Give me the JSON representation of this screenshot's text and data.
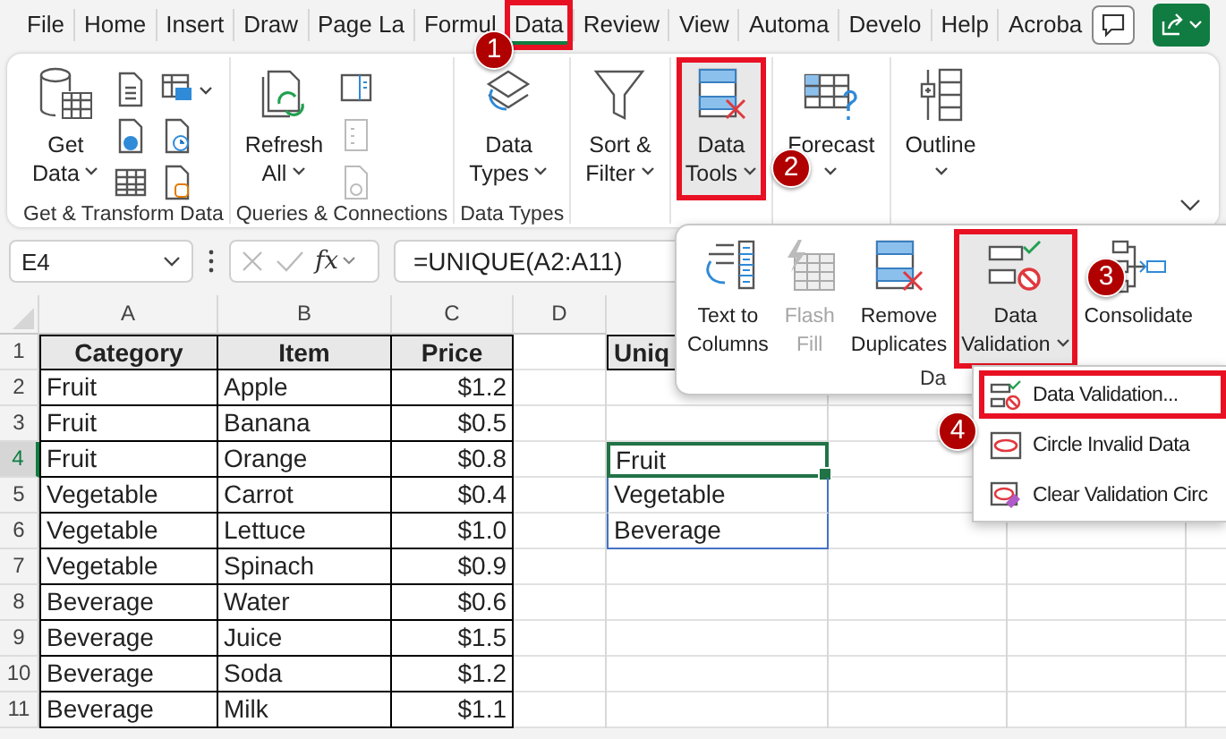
{
  "tabs": [
    {
      "label": "File",
      "selected": false,
      "highlighted": false
    },
    {
      "label": "Home",
      "selected": false,
      "highlighted": false
    },
    {
      "label": "Insert",
      "selected": false,
      "highlighted": false
    },
    {
      "label": "Draw",
      "selected": false,
      "highlighted": false
    },
    {
      "label": "Page La",
      "selected": false,
      "highlighted": false
    },
    {
      "label": "Formul",
      "selected": false,
      "highlighted": false
    },
    {
      "label": "Data",
      "selected": true,
      "highlighted": true
    },
    {
      "label": "Review",
      "selected": false,
      "highlighted": false
    },
    {
      "label": "View",
      "selected": false,
      "highlighted": false
    },
    {
      "label": "Automa",
      "selected": false,
      "highlighted": false
    },
    {
      "label": "Develo",
      "selected": false,
      "highlighted": false
    },
    {
      "label": "Help",
      "selected": false,
      "highlighted": false
    },
    {
      "label": "Acroba",
      "selected": false,
      "highlighted": false
    }
  ],
  "ribbon": {
    "groups": [
      {
        "label": "Get & Transform Data",
        "buttons": [
          {
            "lines": [
              "Get",
              "Data"
            ],
            "dropdown": true,
            "highlighted": false
          }
        ]
      },
      {
        "label": "Queries & Connections",
        "buttons": [
          {
            "lines": [
              "Refresh",
              "All"
            ],
            "dropdown": true,
            "highlighted": false
          }
        ]
      },
      {
        "label": "Data Types",
        "buttons": [
          {
            "lines": [
              "Data",
              "Types"
            ],
            "dropdown": true,
            "highlighted": false
          }
        ]
      },
      {
        "buttons": [
          {
            "lines": [
              "Sort &",
              "Filter"
            ],
            "dropdown": true,
            "highlighted": false
          }
        ]
      },
      {
        "buttons": [
          {
            "lines": [
              "Data",
              "Tools"
            ],
            "dropdown": true,
            "highlighted": true
          }
        ]
      },
      {
        "buttons": [
          {
            "lines": [
              "Forecast"
            ],
            "dropdown": true,
            "highlighted": false
          }
        ]
      },
      {
        "buttons": [
          {
            "lines": [
              "Outline"
            ],
            "dropdown": true,
            "highlighted": false
          }
        ]
      }
    ]
  },
  "formula_bar": {
    "name_box": "E4",
    "function_label": "fx",
    "formula": "=UNIQUE(A2:A11)"
  },
  "sheet": {
    "columns": [
      "A",
      "B",
      "C",
      "D"
    ],
    "rows": [
      {
        "number": "1",
        "selected": false,
        "kind": "header",
        "data": [
          "Category",
          "Item",
          "Price"
        ],
        "spill": {
          "text": "Uniq",
          "selected": false
        }
      },
      {
        "number": "2",
        "selected": false,
        "kind": "body",
        "data": [
          "Fruit",
          "Apple",
          "$1.2"
        ]
      },
      {
        "number": "3",
        "selected": false,
        "kind": "body",
        "data": [
          "Fruit",
          "Banana",
          "$0.5"
        ]
      },
      {
        "number": "4",
        "selected": true,
        "kind": "body",
        "data": [
          "Fruit",
          "Orange",
          "$0.8"
        ],
        "spill": {
          "text": "Fruit",
          "selected": true
        }
      },
      {
        "number": "5",
        "selected": false,
        "kind": "body",
        "data": [
          "Vegetable",
          "Carrot",
          "$0.4"
        ],
        "spill": {
          "text": "Vegetable",
          "selected": false
        }
      },
      {
        "number": "6",
        "selected": false,
        "kind": "body",
        "data": [
          "Vegetable",
          "Lettuce",
          "$1.0"
        ],
        "spill": {
          "text": "Beverage",
          "selected": false
        }
      },
      {
        "number": "7",
        "selected": false,
        "kind": "body",
        "data": [
          "Vegetable",
          "Spinach",
          "$0.9"
        ]
      },
      {
        "number": "8",
        "selected": false,
        "kind": "body",
        "data": [
          "Beverage",
          "Water",
          "$0.6"
        ]
      },
      {
        "number": "9",
        "selected": false,
        "kind": "body",
        "data": [
          "Beverage",
          "Juice",
          "$1.5"
        ]
      },
      {
        "number": "10",
        "selected": false,
        "kind": "body",
        "data": [
          "Beverage",
          "Soda",
          "$1.2"
        ]
      },
      {
        "number": "11",
        "selected": false,
        "kind": "body",
        "data": [
          "Beverage",
          "Milk",
          "$1.1"
        ]
      }
    ]
  },
  "data_tools_panel": {
    "group_label": "Da",
    "buttons": [
      {
        "lines": [
          "Text to",
          "Columns"
        ],
        "disabled": false,
        "highlighted": false,
        "dropdown": false
      },
      {
        "lines": [
          "Flash",
          "Fill"
        ],
        "disabled": true,
        "highlighted": false,
        "dropdown": false
      },
      {
        "lines": [
          "Remove",
          "Duplicates"
        ],
        "disabled": false,
        "highlighted": false,
        "dropdown": false
      },
      {
        "lines": [
          "Data",
          "Validation"
        ],
        "disabled": false,
        "highlighted": true,
        "dropdown": true
      },
      {
        "lines": [
          "Consolidate"
        ],
        "disabled": false,
        "highlighted": false,
        "dropdown": false
      }
    ]
  },
  "validation_menu": {
    "items": [
      {
        "label": "Data Validation...",
        "highlighted": true
      },
      {
        "label": "Circle Invalid Data",
        "highlighted": false
      },
      {
        "label": "Clear Validation Circ",
        "highlighted": false
      }
    ]
  },
  "callouts": [
    "1",
    "2",
    "3",
    "4"
  ]
}
